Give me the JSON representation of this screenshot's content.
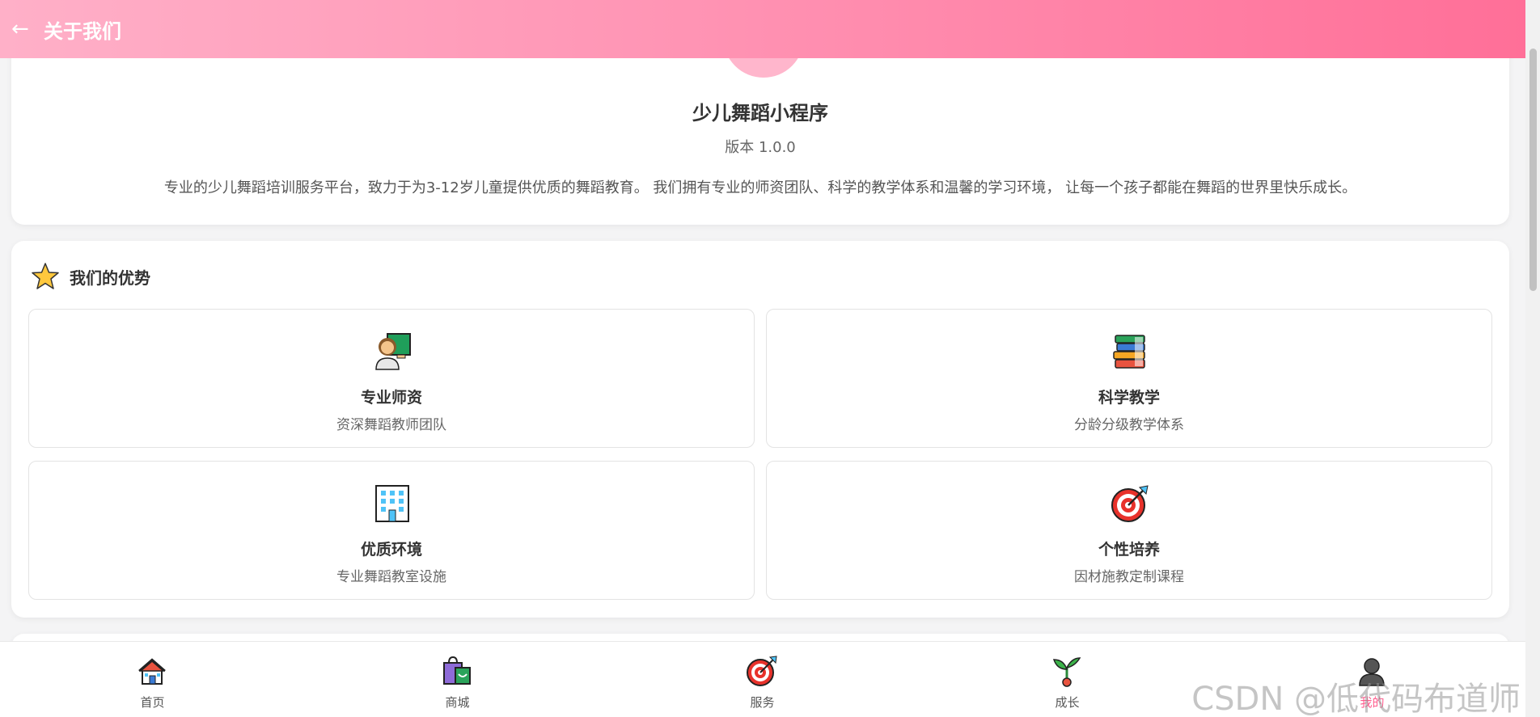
{
  "header": {
    "back_icon": "←",
    "title": "关于我们"
  },
  "intro": {
    "app_name": "少儿舞蹈小程序",
    "version": "版本 1.0.0",
    "description": "专业的少儿舞蹈培训服务平台，致力于为3-12岁儿童提供优质的舞蹈教育。 我们拥有专业的师资团队、科学的教学体系和温馨的学习环境， 让每一个孩子都能在舞蹈的世界里快乐成长。"
  },
  "advantages": {
    "title": "我们的优势",
    "icon": "star-icon",
    "items": [
      {
        "icon": "teacher-icon",
        "title": "专业师资",
        "subtitle": "资深舞蹈教师团队"
      },
      {
        "icon": "books-icon",
        "title": "科学教学",
        "subtitle": "分龄分级教学体系"
      },
      {
        "icon": "building-icon",
        "title": "优质环境",
        "subtitle": "专业舞蹈教室设施"
      },
      {
        "icon": "target-icon",
        "title": "个性培养",
        "subtitle": "因材施教定制课程"
      }
    ]
  },
  "tabbar": {
    "items": [
      {
        "icon": "home-icon",
        "label": "首页"
      },
      {
        "icon": "shopping-bag-icon",
        "label": "商城"
      },
      {
        "icon": "target-icon",
        "label": "服务"
      },
      {
        "icon": "sprout-icon",
        "label": "成长"
      },
      {
        "icon": "person-icon",
        "label": "我的"
      }
    ],
    "active_index": 4
  },
  "watermark": "CSDN @低代码布道师",
  "colors": {
    "header_start": "#ffb0c8",
    "header_end": "#ff6f98",
    "accent": "#ff5c8d"
  }
}
